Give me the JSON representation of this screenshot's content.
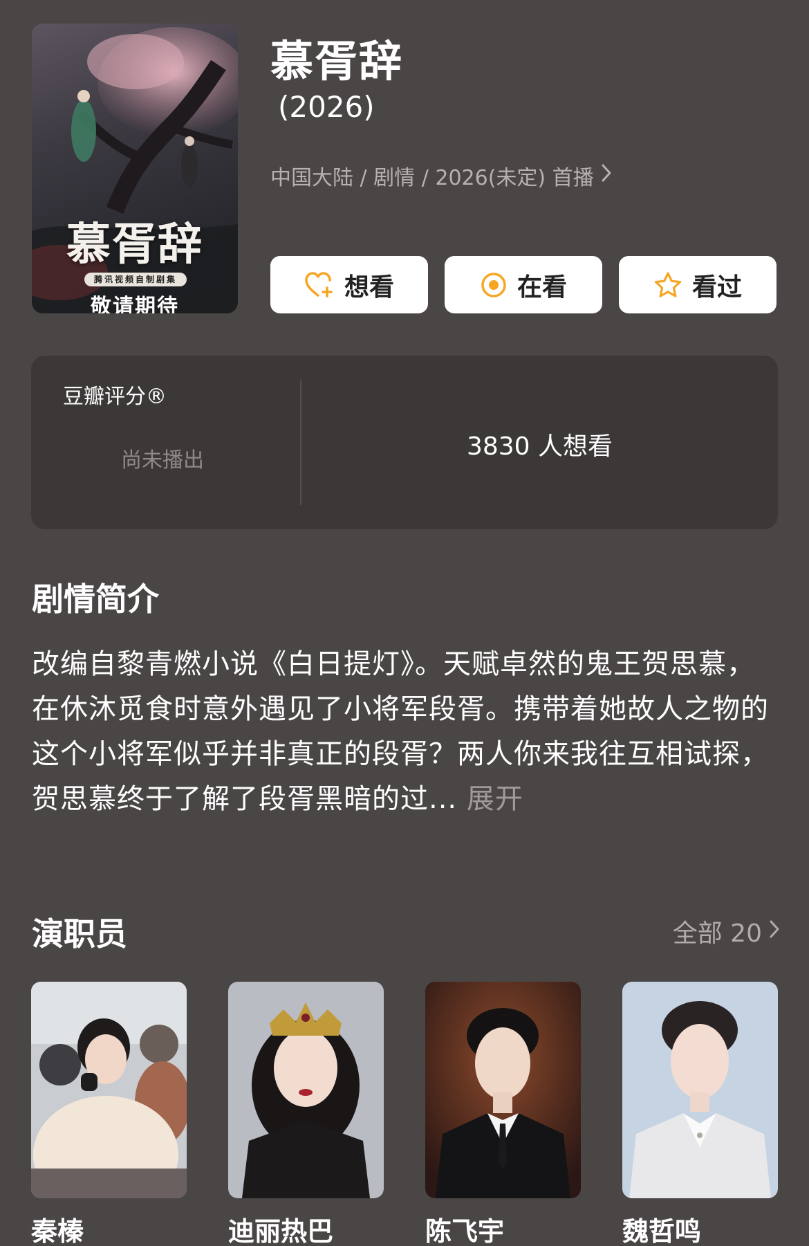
{
  "poster": {
    "title": "慕胥辞",
    "badge": "腾讯视频自制剧集",
    "tagline": "敬请期待"
  },
  "show": {
    "title": "慕胥辞",
    "year": "(2026)",
    "meta": "中国大陆 / 剧情 / 2026(未定) 首播"
  },
  "actions": [
    {
      "label": "想看",
      "icon": "heart-plus-icon"
    },
    {
      "label": "在看",
      "icon": "circle-dot-icon"
    },
    {
      "label": "看过",
      "icon": "star-icon"
    }
  ],
  "rating": {
    "label": "豆瓣评分®",
    "status": "尚未播出",
    "want_count": "3830 人想看"
  },
  "synopsis": {
    "heading": "剧情简介",
    "text": "改编自黎青燃小说《白日提灯》。天赋卓然的鬼王贺思慕，在休沐觅食时意外遇见了小将军段胥。携带着她故人之物的这个小将军似乎并非真正的段胥？两人你来我往互相试探，贺思慕终于了解了段胥黑暗的过...",
    "expand": "展开"
  },
  "cast": {
    "heading": "演职员",
    "all_link": "全部 20",
    "members": [
      {
        "name": "秦榛"
      },
      {
        "name": "迪丽热巴"
      },
      {
        "name": "陈飞宇"
      },
      {
        "name": "魏哲鸣"
      }
    ]
  },
  "colors": {
    "background": "#4b4646",
    "card": "#3c3838",
    "accent": "#f5a623"
  }
}
